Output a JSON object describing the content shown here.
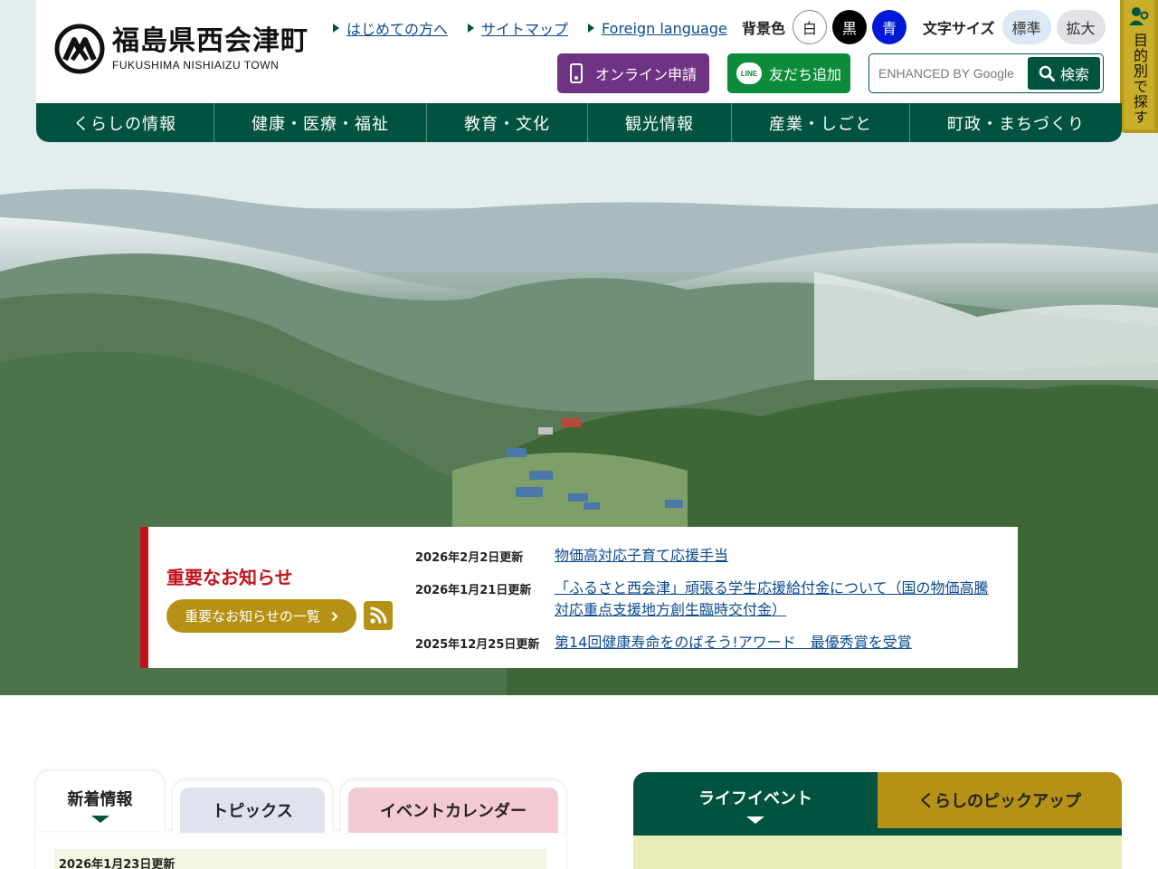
{
  "header": {
    "logo_jp": "福島県西会津町",
    "logo_en": "FUKUSHIMA NISHIAIZU TOWN",
    "top_links": [
      "はじめての方へ",
      "サイトマップ",
      "Foreign language"
    ],
    "bg_color_label": "背景色",
    "bg_colors": [
      "白",
      "黒",
      "青"
    ],
    "font_size_label": "文字サイズ",
    "font_sizes": [
      "標準",
      "拡大"
    ],
    "online_label": "オンライン申請",
    "line_label": "友だち追加",
    "line_icon_text": "LINE",
    "search_placeholder": "ENHANCED BY Google",
    "search_button": "検索",
    "mokuteki": "目的別で探す"
  },
  "nav": [
    "くらしの情報",
    "健康・医療・福祉",
    "教育・文化",
    "観光情報",
    "産業・しごと",
    "町政・まちづくり"
  ],
  "notice": {
    "title": "重要なお知らせ",
    "list_button": "重要なお知らせの一覧",
    "items": [
      {
        "date": "2026年2月2日更新",
        "title": "物価高対応子育て応援手当"
      },
      {
        "date": "2026年1月21日更新",
        "title": "「ふるさと西会津」頑張る学生応援給付金について（国の物価高騰対応重点支援地方創生臨時交付金）"
      },
      {
        "date": "2025年12月25日更新",
        "title": "第14回健康寿命をのばそう!アワード　最優秀賞を受賞"
      }
    ]
  },
  "tabs": {
    "news": "新着情報",
    "topics": "トピックス",
    "events": "イベントカレンダー",
    "first_date": "2026年1月23日更新"
  },
  "life_tabs": {
    "life_event": "ライフイベント",
    "pickup": "くらしのピックアップ"
  },
  "colors": {
    "brand_green": "#00533f",
    "accent_gold": "#b59115",
    "notice_red": "#c1131b",
    "online_purple": "#6f3384",
    "line_green": "#0c8b3a"
  }
}
